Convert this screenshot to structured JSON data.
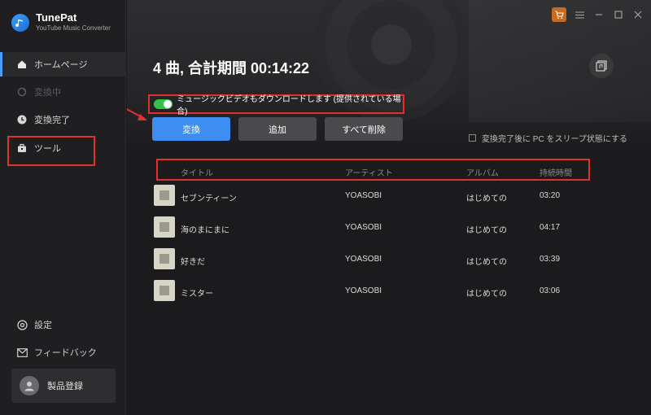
{
  "app": {
    "name": "TunePat",
    "subtitle": "YouTube Music Converter"
  },
  "sidebar": {
    "items": [
      {
        "label": "ホームページ",
        "icon": "home-icon",
        "state": "active"
      },
      {
        "label": "変換中",
        "icon": "sync-icon",
        "state": "disabled"
      },
      {
        "label": "変換完了",
        "icon": "clock-icon",
        "state": "normal"
      },
      {
        "label": "ツール",
        "icon": "toolbox-icon",
        "state": "normal"
      }
    ],
    "bottom": [
      {
        "label": "設定",
        "icon": "gear-icon"
      },
      {
        "label": "フィードバック",
        "icon": "mail-icon"
      }
    ],
    "register_label": "製品登録"
  },
  "main": {
    "summary": "4 曲, 合計期間 00:14:22",
    "music_video_toggle": {
      "on": true,
      "label": "ミュージックビデオもダウンロードします (提供されている場合)"
    },
    "buttons": {
      "convert": "変換",
      "add": "追加",
      "delete_all": "すべて削除"
    },
    "sleep_option": {
      "checked": false,
      "label": "変換完了後に PC をスリープ状態にする"
    },
    "table": {
      "headers": {
        "title": "タイトル",
        "artist": "アーティスト",
        "album": "アルバム",
        "duration": "持続時間"
      },
      "rows": [
        {
          "title": "セブンティーン",
          "artist": "YOASOBI",
          "album": "はじめての",
          "duration": "03:20"
        },
        {
          "title": "海のまにまに",
          "artist": "YOASOBI",
          "album": "はじめての",
          "duration": "04:17"
        },
        {
          "title": "好きだ",
          "artist": "YOASOBI",
          "album": "はじめての",
          "duration": "03:39"
        },
        {
          "title": "ミスター",
          "artist": "YOASOBI",
          "album": "はじめての",
          "duration": "03:06"
        }
      ]
    }
  },
  "colors": {
    "accent": "#3d8ef0",
    "highlight": "#e03030",
    "toggle_on": "#36c24a",
    "cart": "#c96a1e"
  }
}
